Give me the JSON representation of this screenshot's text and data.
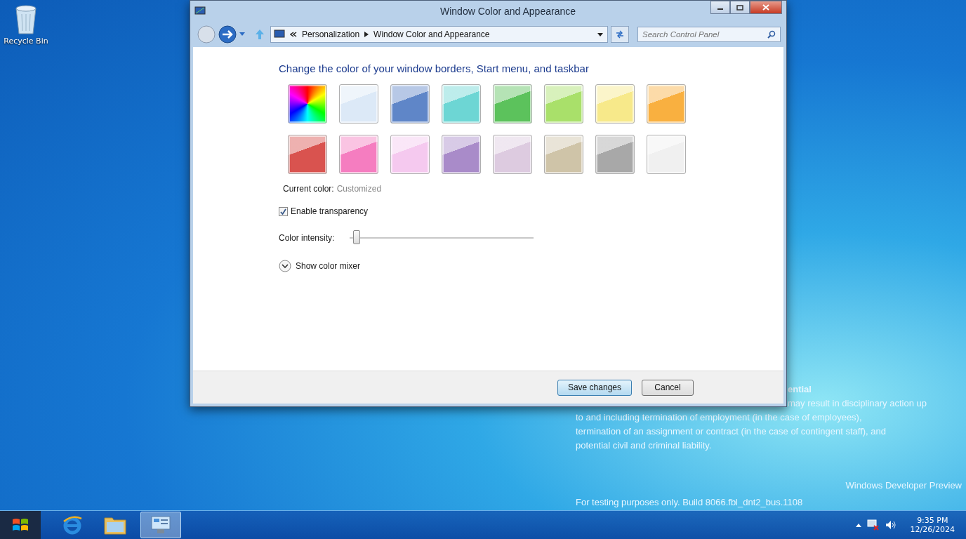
{
  "desktop": {
    "icons": [
      {
        "label": "Recycle Bin"
      }
    ],
    "notice_lines": [
      "ential",
      "may result in disciplinary action up",
      "to and including termination of employment (in the case of employees),",
      "termination of an assignment or contract (in the case of contingent staff), and",
      "potential civil and criminal liability."
    ],
    "edition": "Windows Developer Preview",
    "build": "For testing purposes only. Build 8066.fbl_dnt2_bus.1108"
  },
  "window": {
    "title": "Window Color and Appearance",
    "breadcrumb": [
      "Personalization",
      "Window Color and Appearance"
    ],
    "search": {
      "placeholder": "Search Control Panel"
    },
    "heading": "Change the color of your window borders, Start menu, and taskbar",
    "swatches": [
      {
        "kind": "rainbow"
      },
      {
        "kind": "solid",
        "color": "#dce9f7"
      },
      {
        "kind": "solid",
        "color": "#5f86c8"
      },
      {
        "kind": "solid",
        "color": "#6dd6d4"
      },
      {
        "kind": "solid",
        "color": "#5cc25c"
      },
      {
        "kind": "solid",
        "color": "#a9e06a"
      },
      {
        "kind": "solid",
        "color": "#f7e98a"
      },
      {
        "kind": "solid",
        "color": "#f9b040"
      },
      {
        "kind": "solid",
        "color": "#d9534f"
      },
      {
        "kind": "solid",
        "color": "#f57dc0"
      },
      {
        "kind": "solid",
        "color": "#f5c9ef"
      },
      {
        "kind": "solid",
        "color": "#a98bc9"
      },
      {
        "kind": "solid",
        "color": "#ddcbe0"
      },
      {
        "kind": "solid",
        "color": "#cfc4a8"
      },
      {
        "kind": "solid",
        "color": "#a8a8a8"
      },
      {
        "kind": "solid",
        "color": "#f0f0f0"
      }
    ],
    "current_color_label": "Current color:",
    "current_color_value": "Customized",
    "transparency": {
      "label": "Enable transparency",
      "checked": true
    },
    "intensity": {
      "label": "Color intensity:",
      "level": 0.02
    },
    "mixer": {
      "label": "Show color mixer",
      "expanded": false
    },
    "buttons": [
      "Save changes",
      "Cancel"
    ]
  },
  "taskbar": {
    "time": "9:35 PM",
    "date": "12/26/2024"
  }
}
